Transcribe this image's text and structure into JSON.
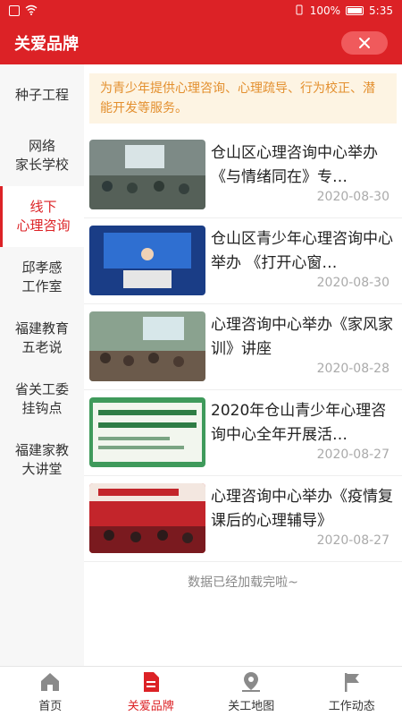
{
  "status_bar": {
    "battery": "100%",
    "time": "5:35"
  },
  "header": {
    "title": "关爱品牌",
    "close_icon": "close-icon"
  },
  "sidebar": {
    "items": [
      {
        "label": "种子工程"
      },
      {
        "label": "网络\n家长学校"
      },
      {
        "label": "线下\n心理咨询"
      },
      {
        "label": "邱孝感\n工作室"
      },
      {
        "label": "福建教育\n五老说"
      },
      {
        "label": "省关工委\n挂钩点"
      },
      {
        "label": "福建家教\n大讲堂"
      }
    ],
    "active_index": 2
  },
  "notice": "为青少年提供心理咨询、心理疏导、行为校正、潜能开发等服务。",
  "articles": [
    {
      "title": "仓山区心理咨询中心举办《与情绪同在》专…",
      "date": "2020-08-30"
    },
    {
      "title": "仓山区青少年心理咨询中心举办 《打开心窗…",
      "date": "2020-08-30"
    },
    {
      "title": "心理咨询中心举办《家风家训》讲座",
      "date": "2020-08-28"
    },
    {
      "title": "2020年仓山青少年心理咨询中心全年开展活…",
      "date": "2020-08-27"
    },
    {
      "title": "心理咨询中心举办《疫情复课后的心理辅导》",
      "date": "2020-08-27"
    }
  ],
  "load_complete": "数据已经加载完啦~",
  "tabs": [
    {
      "label": "首页",
      "icon": "home-icon"
    },
    {
      "label": "关爱品牌",
      "icon": "document-icon"
    },
    {
      "label": "关工地图",
      "icon": "map-pin-icon"
    },
    {
      "label": "工作动态",
      "icon": "flag-icon"
    }
  ],
  "colors": {
    "brand_red": "#dc2226",
    "notice_text": "#e38f2e",
    "notice_bg": "#fdf4e3"
  }
}
